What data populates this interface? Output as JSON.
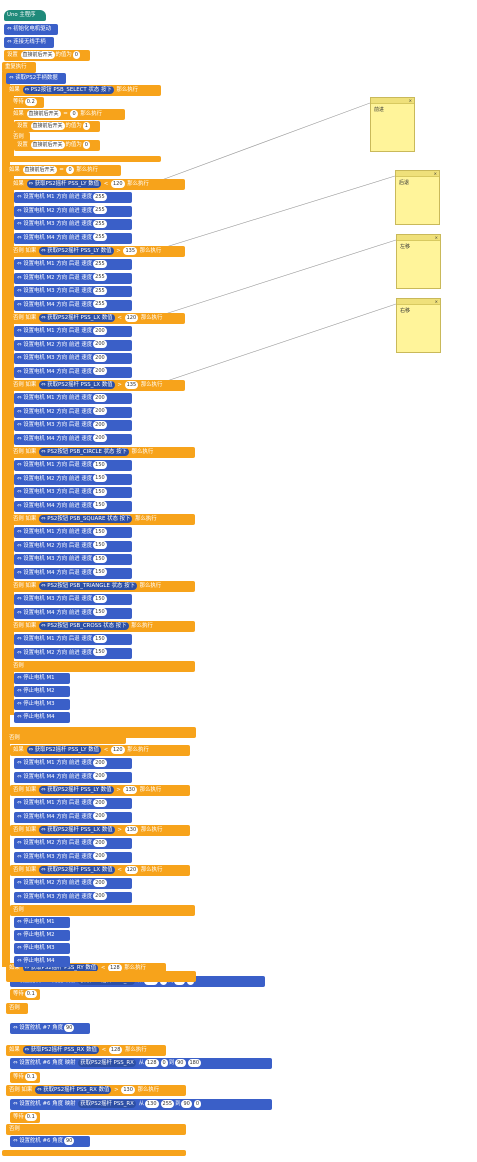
{
  "program": {
    "hat_label": "Uno 主程序",
    "init_motor": "初始化电机驱动",
    "init_ps2": "连接无线手柄",
    "set_var": "设置",
    "var_name": "直接前后开关",
    "to": "的值为",
    "zero": "0",
    "one": "1",
    "repeat": "重复执行",
    "read_ps2": "读取PS2手柄数据",
    "if_label": "如果",
    "else_if": "否则 如果",
    "else": "否则",
    "then": "那么执行",
    "wait": "等待",
    "wait_val": "0.2",
    "ps2_button": "PS2按钮",
    "select": "PSB_SELECT",
    "circle": "PSB_CIRCLE",
    "square": "PSB_SQUARE",
    "triangle": "PSB_TRIANGLE",
    "cross": "PSB_CROSS",
    "state": "状态",
    "pressed": "按下",
    "joy": "获取PS2摇杆",
    "ly": "PSS_LY",
    "lx": "PSS_LX",
    "ry": "PSS_RY",
    "rx": "PSS_RX",
    "val": "数值",
    "lt": "<",
    "gt": ">",
    "v120": "120",
    "v135": "135",
    "v130": "130",
    "set_motor": "设置电机",
    "dir": "方向",
    "fwd": "前进",
    "back": "后退",
    "speed": "速度",
    "s255": "255",
    "s200": "200",
    "s150": "150",
    "stop_motor": "停止电机",
    "m1": "M1",
    "m2": "M2",
    "m3": "M3",
    "m4": "M4",
    "servo": "设置舵机",
    "servo7": "#7",
    "servo6": "#6",
    "angle": "角度",
    "map": "映射",
    "from": "从",
    "map_to": "到",
    "a90": "90",
    "a0": "0",
    "a180": "180",
    "a128": "128",
    "a255": "255",
    "wait_small": "0.1"
  },
  "notes": [
    {
      "label": "前进"
    },
    {
      "label": "后退"
    },
    {
      "label": "左移"
    },
    {
      "label": "右移"
    }
  ],
  "note_close": "×"
}
